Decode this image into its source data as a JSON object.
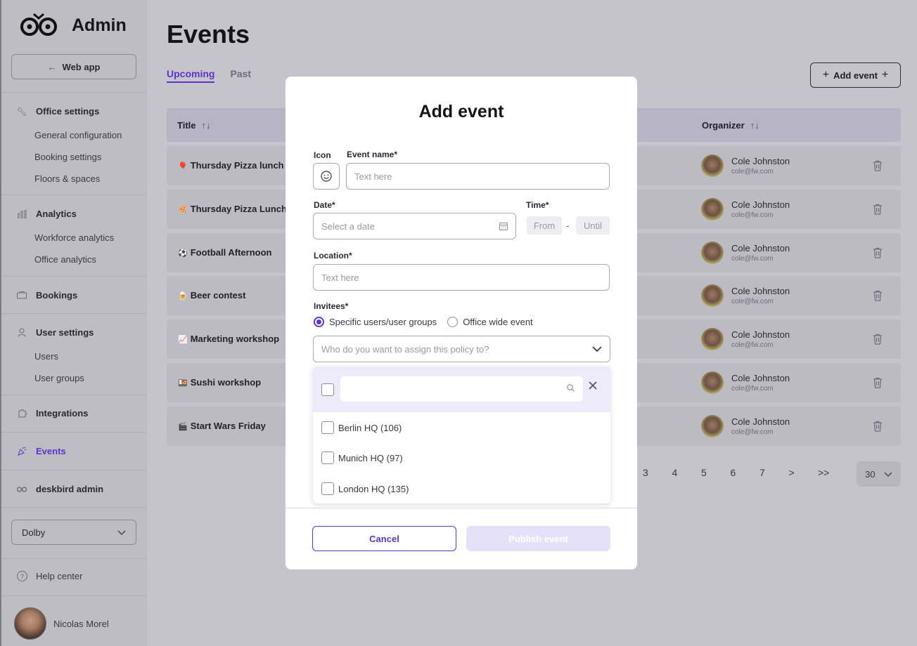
{
  "sidebar": {
    "app_title": "Admin",
    "web_app_label": "Web app",
    "sections": {
      "office_settings": "Office settings",
      "general_configuration": "General configuration",
      "booking_settings": "Booking settings",
      "floors_spaces": "Floors & spaces",
      "analytics": "Analytics",
      "workforce_analytics": "Workforce analytics",
      "office_analytics": "Office analytics",
      "bookings": "Bookings",
      "user_settings": "User settings",
      "users": "Users",
      "user_groups": "User groups",
      "integrations": "Integrations",
      "events": "Events",
      "deskbird_admin": "deskbird admin"
    },
    "office_select": "Dolby",
    "help_center": "Help center",
    "user_name": "Nicolas Morel"
  },
  "main": {
    "page_title": "Events",
    "tabs": [
      "Upcoming",
      "Past"
    ],
    "add_event_label": "Add event",
    "columns": {
      "title": "Title",
      "organizer": "Organizer"
    },
    "rows": [
      {
        "emoji": "🎈",
        "title": "Thursday Pizza lunch",
        "organizer": "Cole Johnston",
        "email": "cole@fw.com"
      },
      {
        "emoji": "🍕",
        "title": "Thursday Pizza Lunch",
        "organizer": "Cole Johnston",
        "email": "cole@fw.com"
      },
      {
        "emoji": "⚽",
        "title": "Football Afternoon",
        "organizer": "Cole Johnston",
        "email": "cole@fw.com"
      },
      {
        "emoji": "🍺",
        "title": "Beer contest",
        "organizer": "Cole Johnston",
        "email": "cole@fw.com"
      },
      {
        "emoji": "📈",
        "title": "Marketing workshop",
        "organizer": "Cole Johnston",
        "email": "cole@fw.com"
      },
      {
        "emoji": "🍱",
        "title": "Sushi workshop",
        "organizer": "Cole Johnston",
        "email": "cole@fw.com"
      },
      {
        "emoji": "🎬",
        "title": "Start Wars Friday",
        "organizer": "Cole Johnston",
        "email": "cole@fw.com"
      }
    ],
    "pagination": [
      "3",
      "4",
      "5",
      "6",
      "7",
      ">",
      ">>"
    ],
    "per_page": "30"
  },
  "modal": {
    "title": "Add event",
    "icon_label": "Icon",
    "event_name_label": "Event name*",
    "event_name_placeholder": "Text here",
    "date_label": "Date*",
    "date_placeholder": "Select a date",
    "time_label": "Time*",
    "time_from": "From",
    "time_separator": "-",
    "time_until": "Until",
    "location_label": "Location*",
    "location_placeholder": "Text here",
    "invitees_label": "Invitees*",
    "radio_specific": "Specific users/user groups",
    "radio_office_wide": "Office wide event",
    "assign_placeholder": "Who do you want to assign this policy to?",
    "options": [
      "Berlin HQ (106)",
      "Munich HQ (97)",
      "London HQ (135)"
    ],
    "cancel_label": "Cancel",
    "publish_label": "Publish event"
  },
  "colors": {
    "accent": "#5b35c9",
    "overlay": "#c5c3cb"
  }
}
